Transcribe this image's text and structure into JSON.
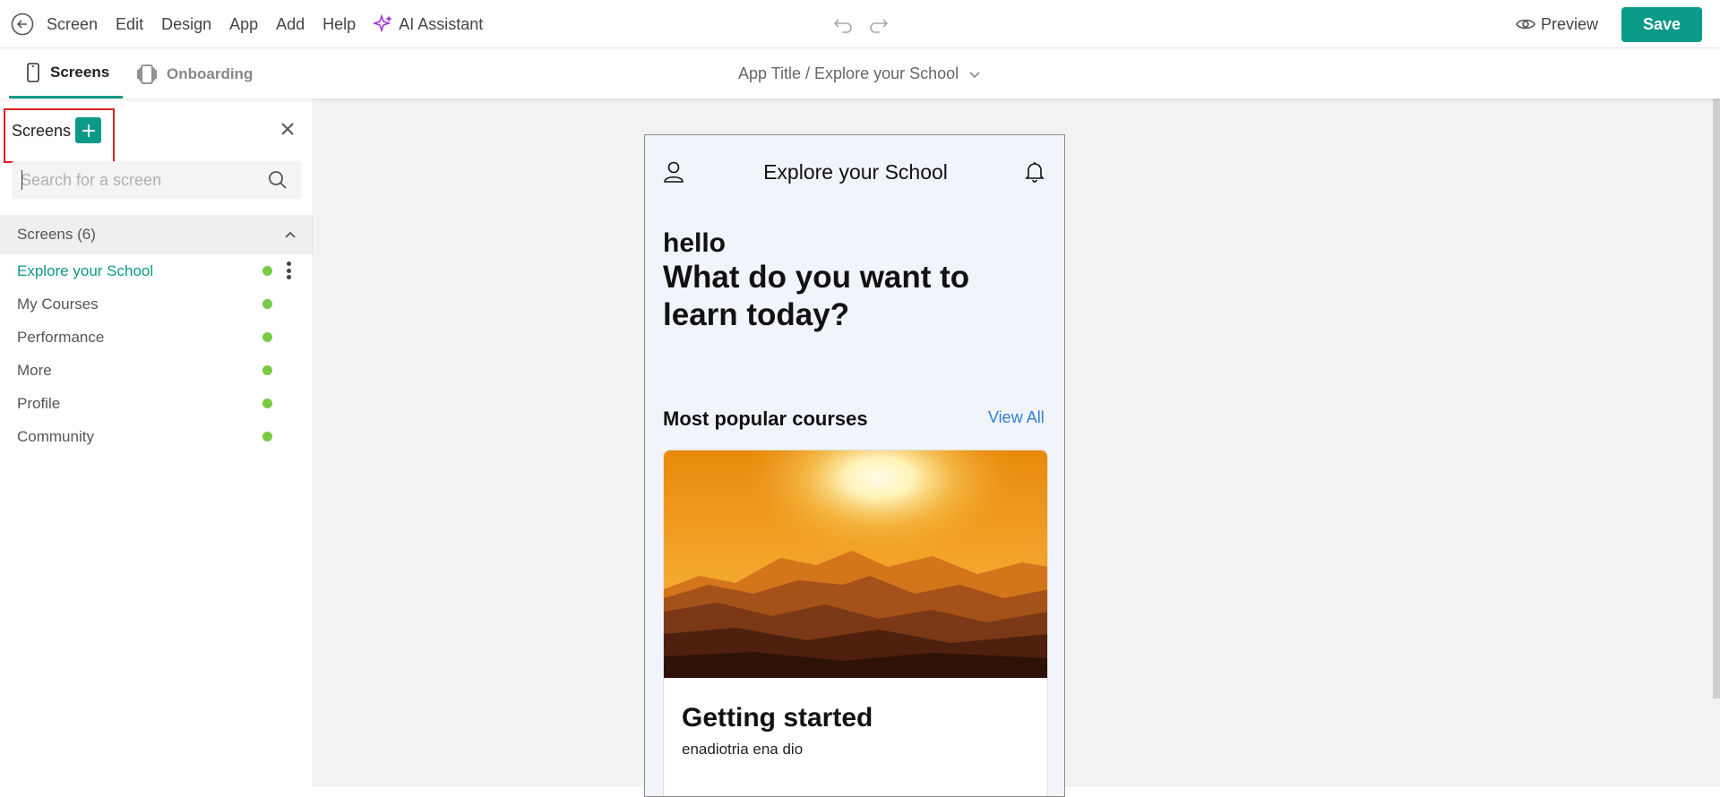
{
  "menu": {
    "items": [
      "Screen",
      "Edit",
      "Design",
      "App",
      "Add",
      "Help"
    ],
    "ai_label": "AI Assistant",
    "preview_label": "Preview",
    "save_label": "Save"
  },
  "tabs": {
    "screens_label": "Screens",
    "onboarding_label": "Onboarding",
    "breadcrumb": "App Title / Explore your School"
  },
  "sidebar": {
    "title": "Screens",
    "search_placeholder": "Search for a screen",
    "group_label": "Screens (6)",
    "items": [
      {
        "label": "Explore your School",
        "active": true
      },
      {
        "label": "My Courses"
      },
      {
        "label": "Performance"
      },
      {
        "label": "More"
      },
      {
        "label": "Profile"
      },
      {
        "label": "Community"
      }
    ]
  },
  "phone": {
    "title": "Explore your School",
    "greeting": "hello",
    "headline": "What do you want to learn today?",
    "section_title": "Most popular courses",
    "view_all": "View All",
    "card": {
      "title": "Getting started",
      "subtitle": "enadiotria ena dio"
    }
  },
  "colors": {
    "accent": "#0a9a87",
    "status_dot": "#7ac943",
    "link": "#2f7fd1",
    "highlight": "#e02020"
  },
  "icons": [
    "back-arrow-icon",
    "sparkle-icon",
    "undo-icon",
    "redo-icon",
    "eye-icon",
    "phone-icon",
    "pages-icon",
    "chevron-down-icon",
    "plus-icon",
    "close-icon",
    "search-icon",
    "chevron-up-icon",
    "kebab-icon",
    "user-icon",
    "bell-icon"
  ]
}
